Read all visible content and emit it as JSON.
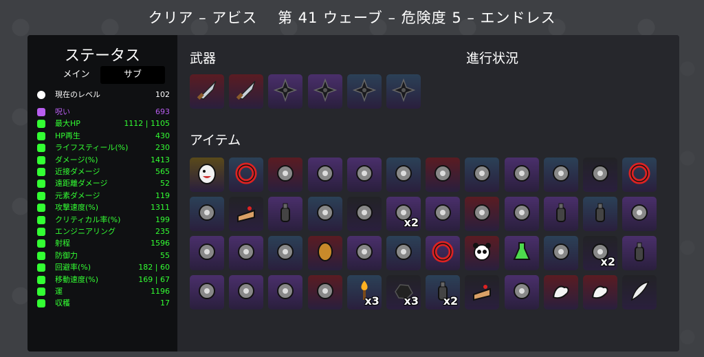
{
  "title": "クリア – アビス　 第 41 ウェーブ – 危険度 5 – エンドレス",
  "sidebar": {
    "heading": "ステータス",
    "tab_main": "メイン",
    "tab_sub": "サブ",
    "level_label": "現在のレベル",
    "level_value": "102",
    "stats": [
      {
        "name": "呪い",
        "value": "693",
        "color": "#b95ef0",
        "icon": "curse-icon"
      },
      {
        "name": "最大HP",
        "value": "1112 | 1105",
        "color": "#33ff33",
        "icon": "heart-icon"
      },
      {
        "name": "HP再生",
        "value": "430",
        "color": "#33ff33",
        "icon": "regen-icon"
      },
      {
        "name": "ライフスティール(%)",
        "value": "230",
        "color": "#33ff33",
        "icon": "lifesteal-icon"
      },
      {
        "name": "ダメージ(%)",
        "value": "1413",
        "color": "#33ff33",
        "icon": "damage-icon"
      },
      {
        "name": "近接ダメージ",
        "value": "565",
        "color": "#33ff33",
        "icon": "melee-icon"
      },
      {
        "name": "遠距離ダメージ",
        "value": "52",
        "color": "#33ff33",
        "icon": "ranged-icon"
      },
      {
        "name": "元素ダメージ",
        "value": "119",
        "color": "#33ff33",
        "icon": "elemental-icon"
      },
      {
        "name": "攻撃速度(%)",
        "value": "1311",
        "color": "#33ff33",
        "icon": "attack-speed-icon"
      },
      {
        "name": "クリティカル率(%)",
        "value": "199",
        "color": "#33ff33",
        "icon": "crit-icon"
      },
      {
        "name": "エンジニアリング",
        "value": "235",
        "color": "#33ff33",
        "icon": "engineering-icon"
      },
      {
        "name": "射程",
        "value": "1596",
        "color": "#33ff33",
        "icon": "range-icon"
      },
      {
        "name": "防御力",
        "value": "55",
        "color": "#33ff33",
        "icon": "armor-icon"
      },
      {
        "name": "回避率(%)",
        "value": "182 | 60",
        "color": "#33ff33",
        "icon": "dodge-icon"
      },
      {
        "name": "移動速度(%)",
        "value": "169 | 67",
        "color": "#33ff33",
        "icon": "speed-icon"
      },
      {
        "name": "運",
        "value": "1196",
        "color": "#33ff33",
        "icon": "luck-icon"
      },
      {
        "name": "収穫",
        "value": "17",
        "color": "#33ff33",
        "icon": "harvest-icon"
      }
    ]
  },
  "weapons_heading": "武器",
  "progress_heading": "進行状況",
  "items_heading": "アイテム",
  "weapons": [
    {
      "icon": "knife-icon",
      "tier": "red"
    },
    {
      "icon": "knife-icon",
      "tier": "red"
    },
    {
      "icon": "shuriken-icon",
      "tier": "purple"
    },
    {
      "icon": "shuriken-icon",
      "tier": "purple"
    },
    {
      "icon": "shuriken-icon",
      "tier": "blue"
    },
    {
      "icon": "shuriken-icon",
      "tier": "blue"
    }
  ],
  "items": [
    {
      "icon": "egg-creature-icon",
      "tier": "gold",
      "mult": ""
    },
    {
      "icon": "gear-ring-icon",
      "tier": "blue",
      "mult": ""
    },
    {
      "icon": "eyeball-icon",
      "tier": "red",
      "mult": ""
    },
    {
      "icon": "handcuffs-icon",
      "tier": "purple",
      "mult": ""
    },
    {
      "icon": "gift-box-icon",
      "tier": "purple",
      "mult": ""
    },
    {
      "icon": "frog-icon",
      "tier": "blue",
      "mult": ""
    },
    {
      "icon": "shell-icon",
      "tier": "red",
      "mult": ""
    },
    {
      "icon": "diving-suit-icon",
      "tier": "blue",
      "mult": ""
    },
    {
      "icon": "helmet-icon",
      "tier": "purple",
      "mult": ""
    },
    {
      "icon": "gauntlet-icon",
      "tier": "blue",
      "mult": ""
    },
    {
      "icon": "snail-icon",
      "tier": "dark",
      "mult": ""
    },
    {
      "icon": "red-ring-icon",
      "tier": "blue",
      "mult": ""
    },
    {
      "icon": "flashlight-icon",
      "tier": "blue",
      "mult": ""
    },
    {
      "icon": "cake-icon",
      "tier": "dark",
      "mult": ""
    },
    {
      "icon": "bottle-icon",
      "tier": "purple",
      "mult": ""
    },
    {
      "icon": "halo-drone-icon",
      "tier": "blue",
      "mult": ""
    },
    {
      "icon": "coffee-cup-icon",
      "tier": "dark",
      "mult": ""
    },
    {
      "icon": "telescope-icon",
      "tier": "purple",
      "mult": "x2"
    },
    {
      "icon": "tentacle-icon",
      "tier": "purple",
      "mult": ""
    },
    {
      "icon": "cat-plant-icon",
      "tier": "red",
      "mult": ""
    },
    {
      "icon": "octopus-icon",
      "tier": "purple",
      "mult": ""
    },
    {
      "icon": "bottle-icon",
      "tier": "purple",
      "mult": ""
    },
    {
      "icon": "bullet-icon",
      "tier": "blue",
      "mult": ""
    },
    {
      "icon": "lantern-icon",
      "tier": "purple",
      "mult": ""
    },
    {
      "icon": "coffee-cup-icon",
      "tier": "purple",
      "mult": ""
    },
    {
      "icon": "claw-icon",
      "tier": "purple",
      "mult": ""
    },
    {
      "icon": "helmet-icon",
      "tier": "blue",
      "mult": ""
    },
    {
      "icon": "potato-icon",
      "tier": "red",
      "mult": ""
    },
    {
      "icon": "skull-icon",
      "tier": "purple",
      "mult": ""
    },
    {
      "icon": "scroll-icon",
      "tier": "blue",
      "mult": ""
    },
    {
      "icon": "red-ring-icon",
      "tier": "purple",
      "mult": ""
    },
    {
      "icon": "panda-icon",
      "tier": "red",
      "mult": ""
    },
    {
      "icon": "potion-icon",
      "tier": "purple",
      "mult": ""
    },
    {
      "icon": "crown-chain-icon",
      "tier": "blue",
      "mult": ""
    },
    {
      "icon": "bee-icon",
      "tier": "dark",
      "mult": "x2"
    },
    {
      "icon": "milk-bottle-icon",
      "tier": "purple",
      "mult": ""
    },
    {
      "icon": "diving-suit-icon",
      "tier": "purple",
      "mult": ""
    },
    {
      "icon": "robed-figure-icon",
      "tier": "purple",
      "mult": ""
    },
    {
      "icon": "wings-icon",
      "tier": "purple",
      "mult": ""
    },
    {
      "icon": "rainbow-leaf-icon",
      "tier": "red",
      "mult": ""
    },
    {
      "icon": "torch-icon",
      "tier": "blue",
      "mult": "x3"
    },
    {
      "icon": "coal-icon",
      "tier": "dark",
      "mult": "x3"
    },
    {
      "icon": "bottle-icon",
      "tier": "blue",
      "mult": "x2"
    },
    {
      "icon": "cake-icon",
      "tier": "dark",
      "mult": ""
    },
    {
      "icon": "cobra-icon",
      "tier": "purple",
      "mult": ""
    },
    {
      "icon": "muscle-arm-icon",
      "tier": "red",
      "mult": ""
    },
    {
      "icon": "muscle-arm-icon",
      "tier": "red",
      "mult": ""
    },
    {
      "icon": "feather-icon",
      "tier": "dark",
      "mult": ""
    }
  ],
  "tier_colors": {
    "gold": "#5a4a1a",
    "blue": "#2b4157",
    "red": "#5a1c22",
    "purple": "#4a2f6b",
    "dark": "#222226"
  }
}
